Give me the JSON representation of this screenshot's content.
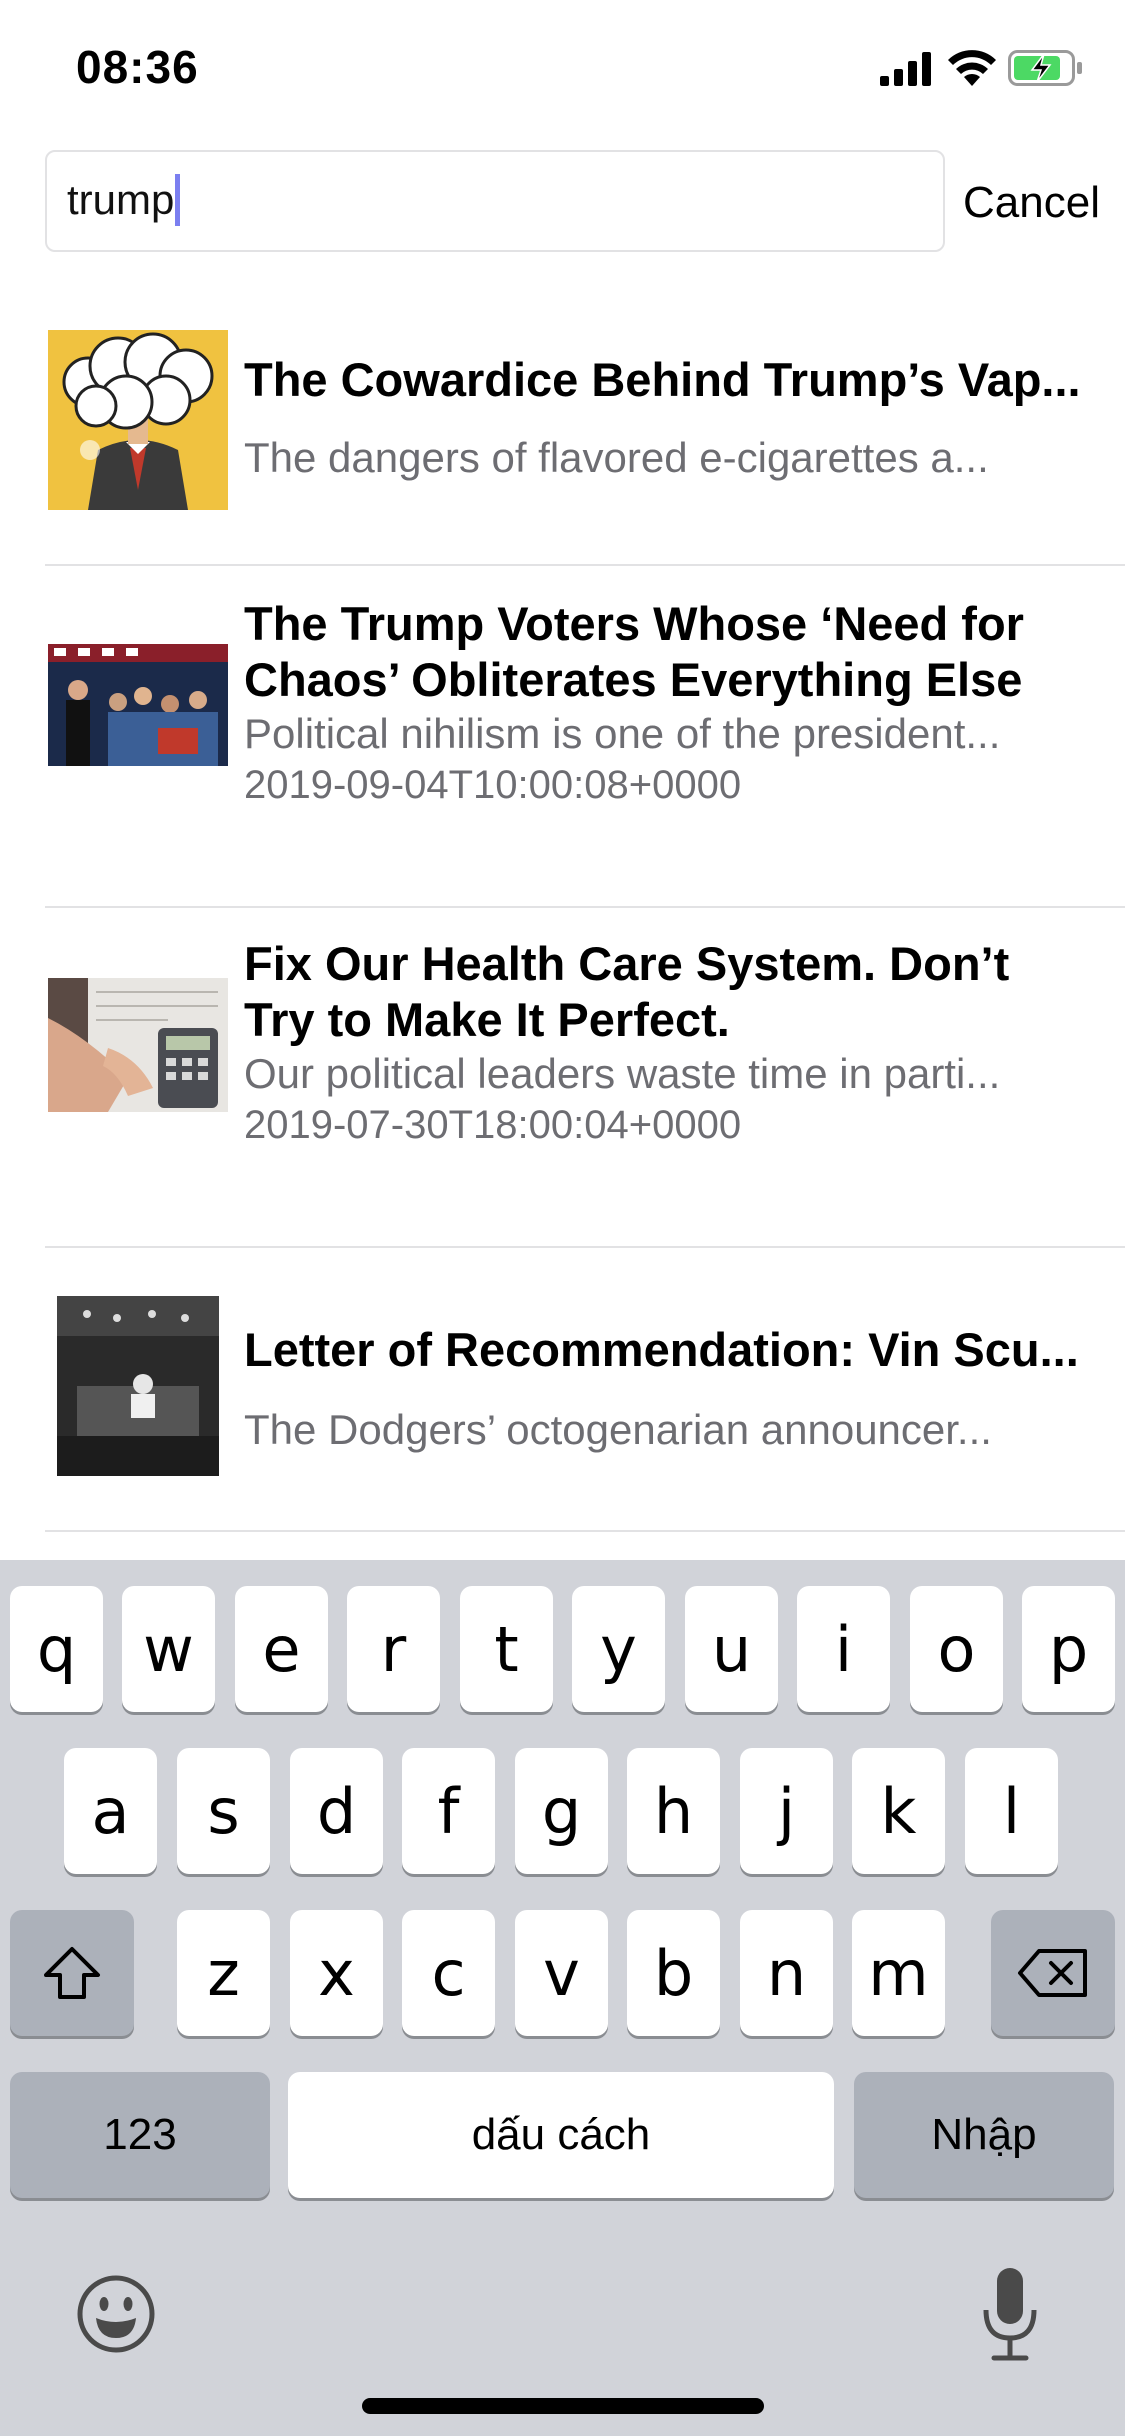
{
  "status_bar": {
    "time": "08:36",
    "icons": [
      "cellular-signal-icon",
      "wifi-icon",
      "battery-charging-icon"
    ],
    "battery_color": "#4cd964"
  },
  "search": {
    "value": "trump",
    "cancel_label": "Cancel",
    "caret_color": "#7b7ff0"
  },
  "results": [
    {
      "title": "The Cowardice Behind Trump’s Vap...",
      "description": "The dangers of flavored e-cigarettes a...",
      "date": "",
      "thumbnail": "cartoon-man-cloud-head-thumbnail"
    },
    {
      "title": "The Trump Voters Whose ‘Need for Chaos’ Obliterates Everything Else",
      "description": "Political nihilism is one of the president...",
      "date": "2019-09-04T10:00:08+0000",
      "thumbnail": "rally-crowd-photo-thumbnail"
    },
    {
      "title": "Fix Our Health Care System. Don’t Try to Make It Perfect.",
      "description": "Our political leaders waste time in parti...",
      "date": "2019-07-30T18:00:04+0000",
      "thumbnail": "medical-bills-calculator-thumbnail"
    },
    {
      "title": "Letter of Recommendation: Vin Scu...",
      "description": "The Dodgers’ octogenarian announcer...",
      "date": "",
      "thumbnail": "broadcast-booth-bw-thumbnail"
    }
  ],
  "keyboard": {
    "row1": [
      "q",
      "w",
      "e",
      "r",
      "t",
      "y",
      "u",
      "i",
      "o",
      "p"
    ],
    "row2": [
      "a",
      "s",
      "d",
      "f",
      "g",
      "h",
      "j",
      "k",
      "l"
    ],
    "row3": [
      "z",
      "x",
      "c",
      "v",
      "b",
      "n",
      "m"
    ],
    "numbers_label": "123",
    "space_label": "dấu cách",
    "return_label": "Nhập",
    "icons": [
      "shift-icon",
      "backspace-icon",
      "emoji-icon",
      "microphone-icon"
    ]
  }
}
